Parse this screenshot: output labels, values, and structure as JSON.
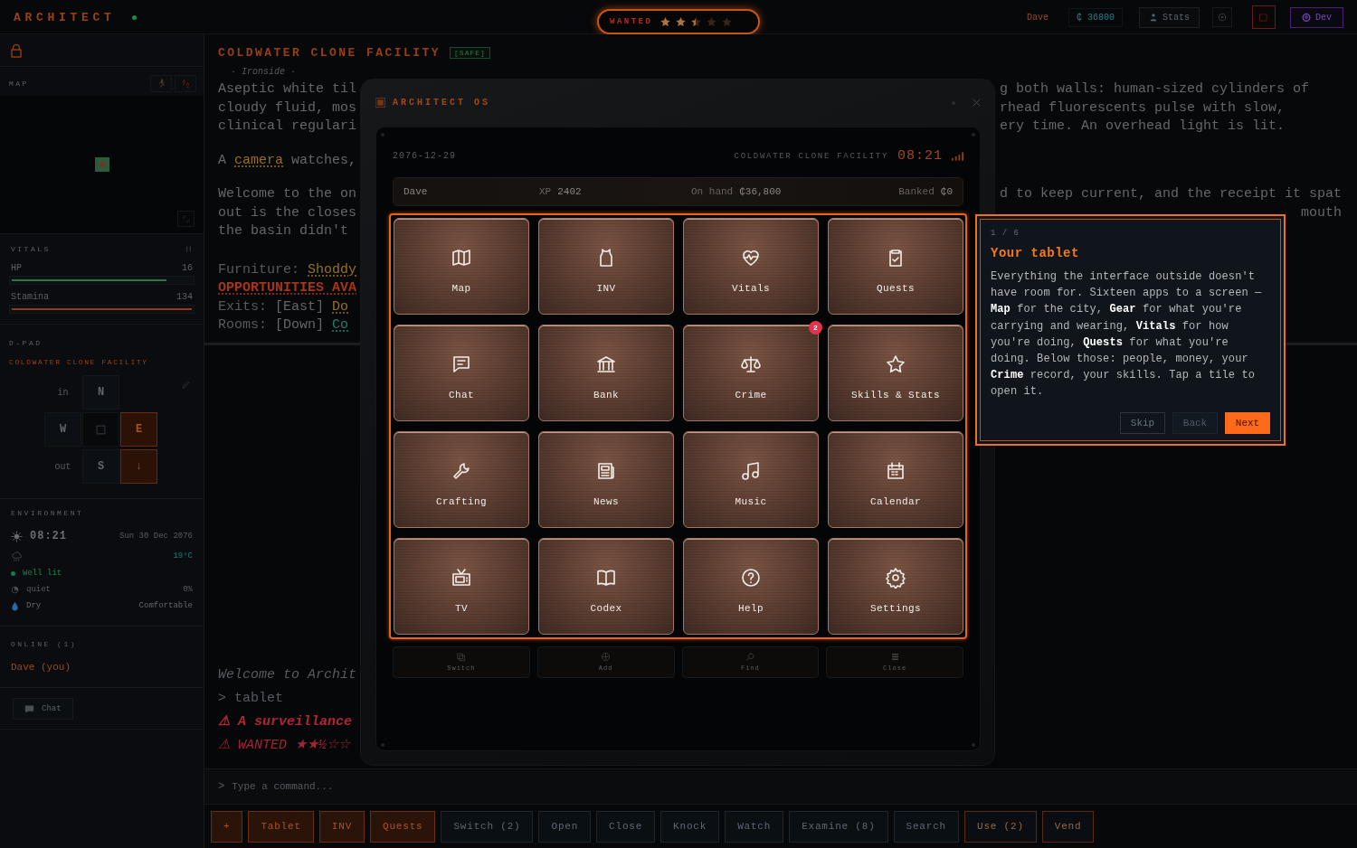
{
  "topbar": {
    "logo": "ARCHITECT",
    "online": true,
    "wanted": {
      "label": "WANTED",
      "stars": 2.5
    },
    "player": "Dave",
    "credits": "₵ 36800",
    "stats_button": "Stats",
    "dev_button": "Dev"
  },
  "sidebar": {
    "map": {
      "title": "MAP"
    },
    "vitals": {
      "title": "VITALS",
      "meters": [
        {
          "name": "HP",
          "value": "16",
          "level": 0.86,
          "color": "#2b7448"
        },
        {
          "name": "Stamina",
          "value": "134",
          "level": 1,
          "color": "#8f3d17"
        }
      ]
    },
    "dpad": {
      "title": "D-PAD",
      "location": "COLDWATER CLONE FACILITY",
      "cells": [
        {
          "kind": "portal",
          "label": "in",
          "exit": false
        },
        {
          "kind": "compass",
          "label": "N",
          "exit": false
        },
        {
          "kind": "blank",
          "exit": false
        },
        {
          "kind": "compass",
          "label": "W",
          "exit": false
        },
        {
          "kind": "center",
          "exit": false
        },
        {
          "kind": "compass",
          "label": "E",
          "exit": true
        },
        {
          "kind": "portal",
          "label": "out",
          "exit": false
        },
        {
          "kind": "compass",
          "label": "S",
          "exit": false
        },
        {
          "kind": "compass",
          "label": "↓",
          "exit": true
        }
      ]
    },
    "environment": {
      "title": "ENVIRONMENT",
      "time": "08:21",
      "date": "Sun 30 Dec 2076",
      "temperature": "19°C",
      "light": "Well lit",
      "noise": "quiet",
      "noise_level": "0%",
      "humidity": "Dry",
      "comfort": "Comfortable"
    },
    "online": {
      "title": "ONLINE (1)",
      "players": [
        {
          "name": "Dave (you)"
        }
      ]
    },
    "chat_button": "Chat"
  },
  "room": {
    "title": "COLDWATER CLONE FACILITY",
    "tag": "[SAFE]",
    "district": "· Ironside ·",
    "paragraphs": [
      {
        "lines": [
          {
            "left": [
              {
                "kind": "text",
                "text": "Aseptic white til"
              }
            ],
            "right": [
              {
                "kind": "text",
                "text": "g both walls: human-sized cylinders of"
              }
            ]
          },
          {
            "left": [
              {
                "kind": "text",
                "text": "cloudy fluid, mos"
              }
            ],
            "right": [
              {
                "kind": "text",
                "text": "rhead fluorescents pulse with slow,"
              }
            ]
          },
          {
            "left": [
              {
                "kind": "text",
                "text": "clinical regulari"
              }
            ],
            "right": [
              {
                "kind": "text",
                "text": "ery time. An overhead light is lit."
              }
            ]
          }
        ]
      },
      {
        "lines": [
          {
            "left": [
              {
                "kind": "text",
                "text": "A "
              },
              {
                "kind": "link",
                "text": "camera"
              },
              {
                "kind": "text",
                "text": " watches,"
              }
            ]
          }
        ]
      },
      {
        "lines": [
          {
            "left": [
              {
                "kind": "text",
                "text": "Welcome to the on"
              }
            ],
            "right": [
              {
                "kind": "text",
                "text": "d to keep current, and the receipt it spat"
              }
            ]
          },
          {
            "left": [
              {
                "kind": "text",
                "text": "out is the closes"
              }
            ],
            "right": [
              {
                "kind": "tail",
                "text": "mouth"
              }
            ]
          },
          {
            "left": [
              {
                "kind": "text",
                "text": "the basin didn't"
              }
            ]
          }
        ]
      }
    ],
    "details": [
      [
        {
          "kind": "label",
          "text": "Furniture: "
        },
        {
          "kind": "link",
          "text": "Shoddy"
        }
      ],
      [
        {
          "kind": "alert",
          "text": "OPPORTUNITIES AVA"
        }
      ],
      [
        {
          "kind": "label",
          "text": "Exits: "
        },
        {
          "kind": "text",
          "text": "[East] "
        },
        {
          "kind": "link",
          "text": "Do"
        }
      ],
      [
        {
          "kind": "label",
          "text": "Rooms: "
        },
        {
          "kind": "text",
          "text": "[Down] "
        },
        {
          "kind": "place",
          "text": "Co"
        }
      ]
    ]
  },
  "log": [
    {
      "kind": "system",
      "text": "Welcome to Archit"
    },
    {
      "kind": "command",
      "text": "> tablet"
    },
    {
      "kind": "alert",
      "text": "⚠ A surveillance"
    },
    {
      "kind": "warning",
      "text": "⚠ WANTED ★★½☆☆"
    }
  ],
  "command": {
    "prompt": ">",
    "placeholder": "Type a command..."
  },
  "actions": [
    {
      "label": "+",
      "kind": "quick"
    },
    {
      "label": "Tablet",
      "kind": "quick"
    },
    {
      "label": "INV",
      "kind": "quick"
    },
    {
      "label": "Quests",
      "kind": "quick"
    },
    {
      "label": "Switch (2)",
      "kind": "action"
    },
    {
      "label": "Open",
      "kind": "action"
    },
    {
      "label": "Close",
      "kind": "action"
    },
    {
      "label": "Knock",
      "kind": "action"
    },
    {
      "label": "Watch",
      "kind": "action"
    },
    {
      "label": "Examine (8)",
      "kind": "action"
    },
    {
      "label": "Search",
      "kind": "action"
    },
    {
      "label": "Use (2)",
      "kind": "item"
    },
    {
      "label": "Vend",
      "kind": "item"
    }
  ],
  "tablet": {
    "title": "ARCHITECT OS",
    "date": "2076-12-29",
    "location": "COLDWATER CLONE FACILITY",
    "time": "08:21",
    "profile": {
      "name": "Dave",
      "stats": [
        {
          "label": "XP",
          "value": "2402"
        },
        {
          "label": "On hand",
          "value": "₵36,800"
        },
        {
          "label": "Banked",
          "value": "₵0"
        }
      ]
    },
    "highlighted": true,
    "apps": [
      {
        "label": "Map"
      },
      {
        "label": "INV"
      },
      {
        "label": "Vitals"
      },
      {
        "label": "Quests"
      },
      {
        "label": "Chat"
      },
      {
        "label": "Bank"
      },
      {
        "label": "Crime",
        "badge": "2"
      },
      {
        "label": "Skills & Stats"
      },
      {
        "label": "Crafting"
      },
      {
        "label": "News"
      },
      {
        "label": "Music"
      },
      {
        "label": "Calendar"
      },
      {
        "label": "TV"
      },
      {
        "label": "Codex"
      },
      {
        "label": "Help"
      },
      {
        "label": "Settings"
      }
    ],
    "dock": [
      {
        "label": "Switch"
      },
      {
        "label": "Add"
      },
      {
        "label": "Find"
      },
      {
        "label": "Close"
      }
    ]
  },
  "tour": {
    "step": "1 / 6",
    "title": "Your tablet",
    "body": "Everything the interface outside doesn't have room for. Sixteen apps to a screen — **Map** for the city, **Gear** for what you're carrying and wearing, **Vitals** for how you're doing, **Quests** for what you're doing. Below those: people, money, your **Crime** record, your skills. Tap a tile to open it.",
    "buttons": [
      {
        "label": "Skip",
        "primary": false,
        "disabled": false
      },
      {
        "label": "Back",
        "primary": false,
        "disabled": true
      },
      {
        "label": "Next",
        "primary": true,
        "disabled": false
      }
    ]
  }
}
